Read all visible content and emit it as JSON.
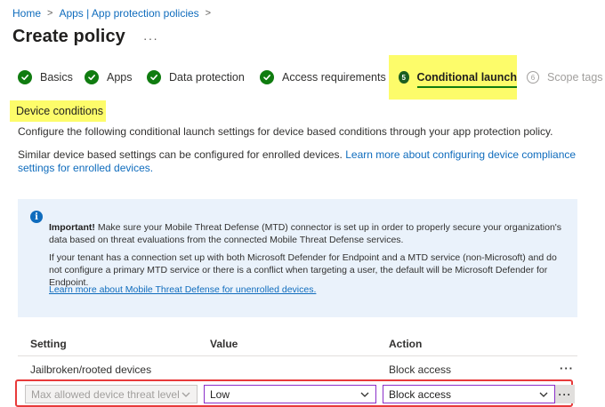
{
  "breadcrumb": {
    "home": "Home",
    "parent": "Apps | App protection policies",
    "sep": ">"
  },
  "page": {
    "title": "Create policy",
    "more": "···"
  },
  "steps": [
    {
      "label": "Basics",
      "state": "done"
    },
    {
      "label": "Apps",
      "state": "done"
    },
    {
      "label": "Data protection",
      "state": "done"
    },
    {
      "label": "Access requirements",
      "state": "done"
    },
    {
      "label": "Conditional launch",
      "state": "active",
      "number": "5"
    },
    {
      "label": "Scope tags",
      "state": "pending",
      "number": "6"
    }
  ],
  "section": {
    "title": "Device conditions"
  },
  "description": {
    "line1": "Configure the following conditional launch settings for device based conditions through your app protection policy.",
    "line2_text": "Similar device based settings can be configured for enrolled devices.",
    "line2_link": "Learn more about configuring device compliance settings for enrolled devices."
  },
  "info": {
    "icon": "i",
    "bold": "Important!",
    "para1": "Make sure your Mobile Threat Defense (MTD) connector is set up in order to properly secure your organization's data based on threat evaluations from the connected Mobile Threat Defense services.",
    "para2": "If your tenant has a connection set up with both Microsoft Defender for Endpoint and a MTD service (non-Microsoft) and do not configure a primary MTD service or there is a conflict when targeting a user, the default will be Microsoft Defender for Endpoint.",
    "link": "Learn more about Mobile Threat Defense for unenrolled devices."
  },
  "table": {
    "headers": {
      "setting": "Setting",
      "value": "Value",
      "action": "Action"
    },
    "row1": {
      "setting": "Jailbroken/rooted devices",
      "value": "",
      "action": "Block access",
      "more": "···"
    },
    "edit": {
      "setting_placeholder": "Max allowed device threat level",
      "value": "Low",
      "action": "Block access",
      "more": "···"
    }
  },
  "colors": {
    "accent": "#0f6cbd",
    "success": "#107c10",
    "highlight": "#fdfc6a",
    "error_border": "#e83a3a",
    "focus_border": "#8b2fc9"
  }
}
